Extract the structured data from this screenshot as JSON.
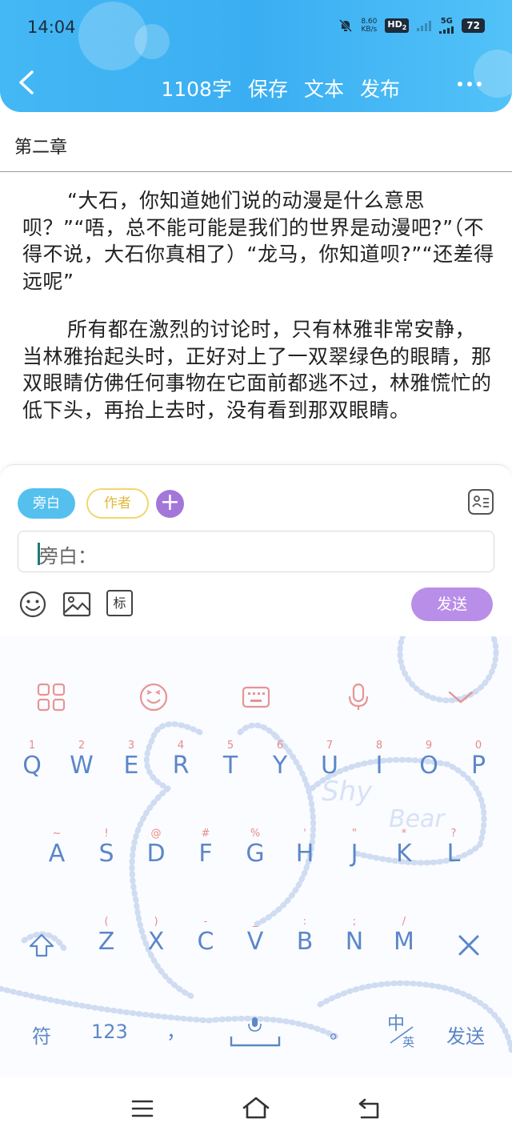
{
  "status_bar": {
    "time": "14:04",
    "net_speed_value": "8.60",
    "net_speed_unit": "KB/s",
    "hd_label": "HD",
    "hd_sub": "2",
    "network_label": "5G",
    "battery": "72"
  },
  "toolbar": {
    "word_count": "1108字",
    "save_label": "保存",
    "text_label": "文本",
    "publish_label": "发布"
  },
  "chapter_title": "第二章",
  "paragraphs": [
    "“大石，你知道她们说的动漫是什么意思呗？”“唔，总不能可能是我们的世界是动漫吧?”（不得不说，大石你真相了）“龙马，你知道呗?”“还差得远呢”",
    "所有都在激烈的讨论时，只有林雅非常安静，当林雅抬起头时，正好对上了一双翠绿色的眼睛，那双眼睛仿佛任何事物在它面前都逃不过，林雅慌忙的低下头，再抬上去时，没有看到那双眼睛。"
  ],
  "composer": {
    "chip_narration": "旁白",
    "chip_author": "作者",
    "add_symbol": "+",
    "input_placeholder": "旁白：",
    "tag_label": "标",
    "send_label": "发送"
  },
  "keyboard": {
    "row1": [
      {
        "hint": "1",
        "letter": "Q"
      },
      {
        "hint": "2",
        "letter": "W"
      },
      {
        "hint": "3",
        "letter": "E"
      },
      {
        "hint": "4",
        "letter": "R"
      },
      {
        "hint": "5",
        "letter": "T"
      },
      {
        "hint": "6",
        "letter": "Y"
      },
      {
        "hint": "7",
        "letter": "U"
      },
      {
        "hint": "8",
        "letter": "I"
      },
      {
        "hint": "9",
        "letter": "O"
      },
      {
        "hint": "0",
        "letter": "P"
      }
    ],
    "row2": [
      {
        "hint": "~",
        "letter": "A"
      },
      {
        "hint": "!",
        "letter": "S"
      },
      {
        "hint": "@",
        "letter": "D"
      },
      {
        "hint": "#",
        "letter": "F"
      },
      {
        "hint": "%",
        "letter": "G"
      },
      {
        "hint": "'",
        "letter": "H"
      },
      {
        "hint": "\"",
        "letter": "J"
      },
      {
        "hint": "*",
        "letter": "K"
      },
      {
        "hint": "?",
        "letter": "L"
      }
    ],
    "row3": [
      {
        "hint": "(",
        "letter": "Z"
      },
      {
        "hint": ")",
        "letter": "X"
      },
      {
        "hint": "-",
        "letter": "C"
      },
      {
        "hint": "_",
        "letter": "V"
      },
      {
        "hint": ":",
        "letter": "B"
      },
      {
        "hint": ";",
        "letter": "N"
      },
      {
        "hint": "/",
        "letter": "M"
      }
    ],
    "symbols_label": "符",
    "numbers_label": "123",
    "comma_label": "，",
    "period_label": "。",
    "lang_zh": "中",
    "lang_en": "英",
    "send_label": "发送",
    "decor_text_1": "Shy",
    "decor_text_2": "Bear"
  },
  "colors": {
    "header": "#3fb3f3",
    "chip_narration": "#55c0ee",
    "chip_author": "#f3d66e",
    "add_button": "#a277d9",
    "send_button": "#b98ee8",
    "key_letter": "#5b87c8",
    "key_hint": "#e88a8a"
  }
}
